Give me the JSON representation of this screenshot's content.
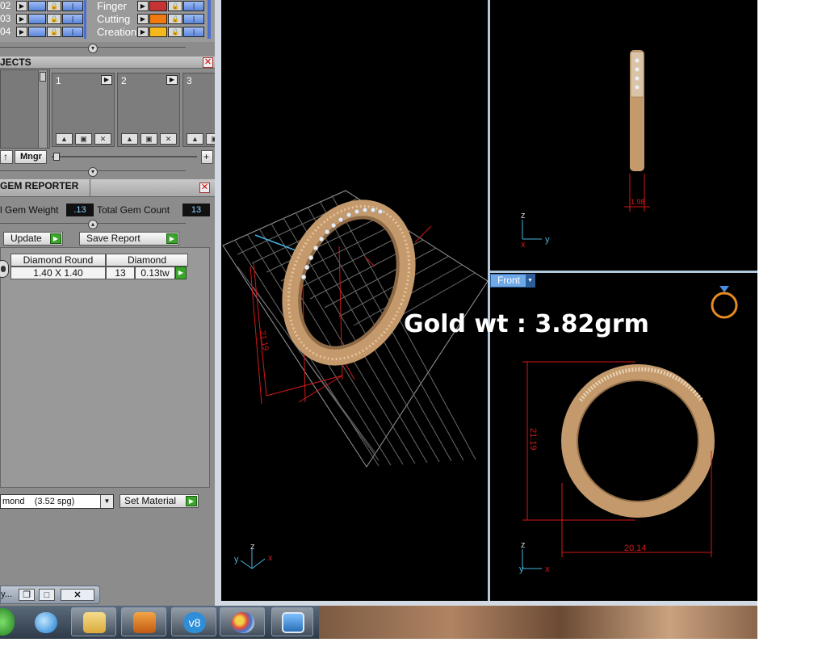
{
  "layers": {
    "rows": [
      {
        "num": "02"
      },
      {
        "num": "03"
      },
      {
        "num": "04"
      }
    ],
    "materials": [
      {
        "label": "Finger",
        "color": "#c83232"
      },
      {
        "label": "Cutting",
        "color": "#f07a10"
      },
      {
        "label": "Creation",
        "color": "#f5b81e"
      }
    ]
  },
  "objects_panel": {
    "title": "JECTS",
    "slots": [
      "1",
      "2",
      "3"
    ],
    "mngr_label": "Mngr",
    "up_label": "↑",
    "plus_label": "+"
  },
  "gem_reporter": {
    "title": "GEM REPORTER",
    "gem_weight_label": "l Gem Weight",
    "gem_weight_value": ".13",
    "total_count_label": "Total Gem Count",
    "total_count_value": "13",
    "update_label": "Update",
    "save_report_label": "Save Report",
    "table": {
      "headers": [
        "Diamond Round",
        "Diamond"
      ],
      "row": {
        "size": "1.40 X 1.40",
        "count": "13",
        "weight": "0.13tw"
      }
    },
    "material_select": "mond    (3.52 spg)",
    "set_material_label": "Set Material"
  },
  "mini_window": {
    "label": "y..."
  },
  "viewports": {
    "front_tab_label": "Front",
    "overlay_text": "Gold wt : 3.82grm",
    "dims": {
      "top_right_width": "1.98",
      "front_height": "21.19",
      "front_width": "20.14",
      "persp_height": "21.19"
    },
    "axes": {
      "x": "x",
      "y": "y",
      "z": "z"
    }
  },
  "taskbar": {
    "apps": [
      "start-orb-icon",
      "internet-explorer-icon",
      "file-explorer-icon",
      "media-player-icon",
      "v8-app-icon",
      "paint-icon",
      "picture-viewer-icon"
    ],
    "v8_label": "v8"
  },
  "colors": {
    "gold": "#d4a77c",
    "dimension_red": "#d41818",
    "axis_blue": "#48b4e0"
  }
}
